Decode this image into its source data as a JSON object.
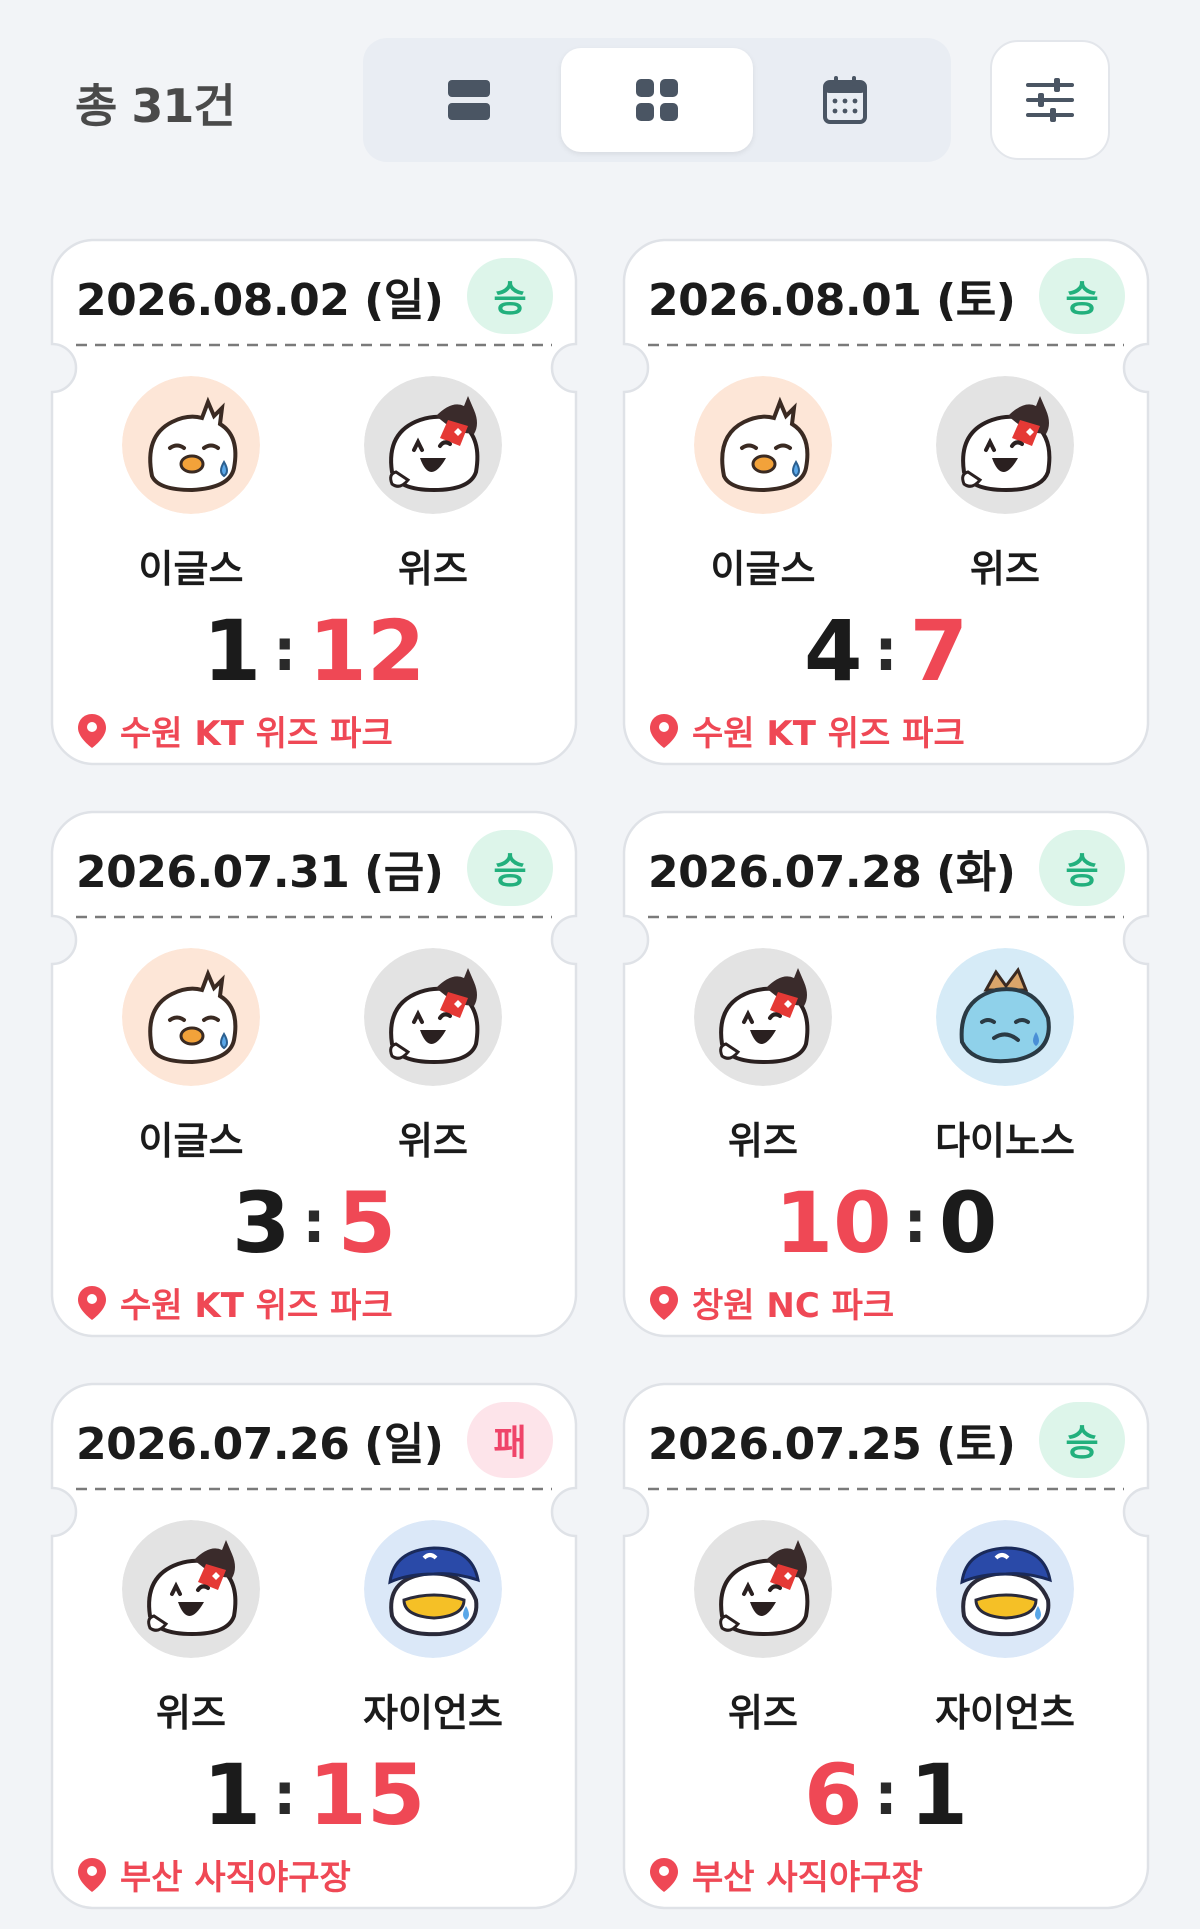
{
  "header": {
    "total_label": "총 31건",
    "view_modes": [
      {
        "name": "list-view",
        "active": false
      },
      {
        "name": "grid-view",
        "active": true
      },
      {
        "name": "calendar-view",
        "active": false
      }
    ]
  },
  "colors": {
    "win_text": "#22b07d",
    "win_bg": "#ddf5ea",
    "lose_text": "#ef4469",
    "lose_bg": "#fde4ea",
    "winning_score": "#ef4855",
    "losing_score": "#1b1b1b",
    "venue": "#ef4855"
  },
  "games": [
    {
      "date": "2026.08.02 (일)",
      "result": "승",
      "result_type": "win",
      "team_left": "이글스",
      "team_right": "위즈",
      "logo_left": "eagles-mascot-icon",
      "logo_right": "wiz-mascot-icon",
      "score_left": "1",
      "score_right": "12",
      "venue": "수원 KT 위즈 파크"
    },
    {
      "date": "2026.08.01 (토)",
      "result": "승",
      "result_type": "win",
      "team_left": "이글스",
      "team_right": "위즈",
      "logo_left": "eagles-mascot-icon",
      "logo_right": "wiz-mascot-icon",
      "score_left": "4",
      "score_right": "7",
      "venue": "수원 KT 위즈 파크"
    },
    {
      "date": "2026.07.31 (금)",
      "result": "승",
      "result_type": "win",
      "team_left": "이글스",
      "team_right": "위즈",
      "logo_left": "eagles-mascot-icon",
      "logo_right": "wiz-mascot-icon",
      "score_left": "3",
      "score_right": "5",
      "venue": "수원 KT 위즈 파크"
    },
    {
      "date": "2026.07.28 (화)",
      "result": "승",
      "result_type": "win",
      "team_left": "위즈",
      "team_right": "다이노스",
      "logo_left": "wiz-mascot-icon",
      "logo_right": "dinos-mascot-icon",
      "score_left": "10",
      "score_right": "0",
      "venue": "창원 NC 파크"
    },
    {
      "date": "2026.07.26 (일)",
      "result": "패",
      "result_type": "lose",
      "team_left": "위즈",
      "team_right": "자이언츠",
      "logo_left": "wiz-mascot-icon",
      "logo_right": "giants-mascot-icon",
      "score_left": "1",
      "score_right": "15",
      "venue": "부산 사직야구장"
    },
    {
      "date": "2026.07.25 (토)",
      "result": "승",
      "result_type": "win",
      "team_left": "위즈",
      "team_right": "자이언츠",
      "logo_left": "wiz-mascot-icon",
      "logo_right": "giants-mascot-icon",
      "score_left": "6",
      "score_right": "1",
      "venue": "부산 사직야구장"
    }
  ]
}
